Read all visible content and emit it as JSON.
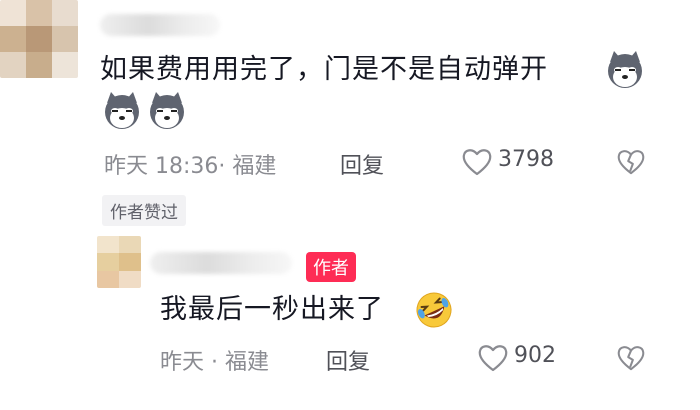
{
  "comments": [
    {
      "text": "如果费用用完了，门是不是自动弹开",
      "emojis": [
        "husky-emoji",
        "husky-emoji",
        "husky-emoji"
      ],
      "time": "昨天 18:36",
      "location": "· 福建",
      "reply_label": "回复",
      "like_count": "3798",
      "badge": "作者赞过"
    },
    {
      "author_badge": "作者",
      "text": "我最后一秒出来了",
      "emojis": [
        "rolling-laughing-emoji"
      ],
      "time": "昨天",
      "location": "· 福建",
      "reply_label": "回复",
      "like_count": "902"
    }
  ],
  "colors": {
    "author_badge": "#fe2c55",
    "meta_text": "#8a8b91"
  }
}
